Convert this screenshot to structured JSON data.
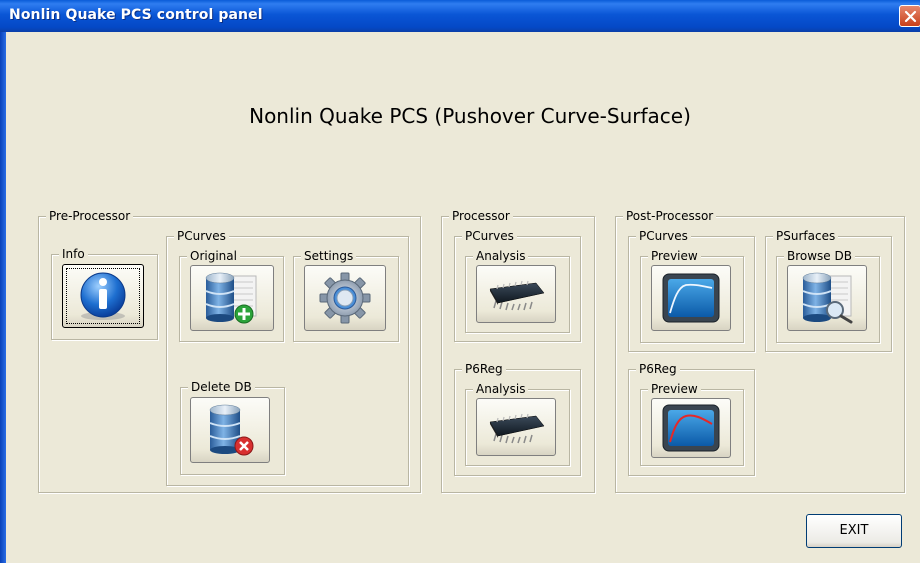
{
  "window": {
    "title": "Nonlin Quake PCS control panel"
  },
  "heading": "Nonlin Quake PCS (Pushover Curve-Surface)",
  "pre_processor": {
    "label": "Pre-Processor",
    "info": {
      "label": "Info",
      "icon": "info-icon"
    },
    "pcurves": {
      "label": "PCurves",
      "original": {
        "label": "Original",
        "icon": "database-add-icon"
      },
      "settings": {
        "label": "Settings",
        "icon": "gear-icon"
      },
      "delete_db": {
        "label": "Delete DB",
        "icon": "database-delete-icon"
      }
    }
  },
  "processor": {
    "label": "Processor",
    "pcurves": {
      "label": "PCurves",
      "analysis": {
        "label": "Analysis",
        "icon": "chip-icon"
      }
    },
    "p6reg": {
      "label": "P6Reg",
      "analysis": {
        "label": "Analysis",
        "icon": "chip-icon"
      }
    }
  },
  "post_processor": {
    "label": "Post-Processor",
    "pcurves": {
      "label": "PCurves",
      "preview": {
        "label": "Preview",
        "icon": "curve-monitor-icon"
      }
    },
    "psurfaces": {
      "label": "PSurfaces",
      "browse_db": {
        "label": "Browse DB",
        "icon": "database-search-icon"
      }
    },
    "p6reg": {
      "label": "P6Reg",
      "preview": {
        "label": "Preview",
        "icon": "curve-monitor-icon"
      }
    }
  },
  "exit": {
    "label": "EXIT"
  },
  "colors": {
    "titlebar": "#0a56d6",
    "window_bg": "#ece9d8",
    "close_button": "#c8401c"
  }
}
